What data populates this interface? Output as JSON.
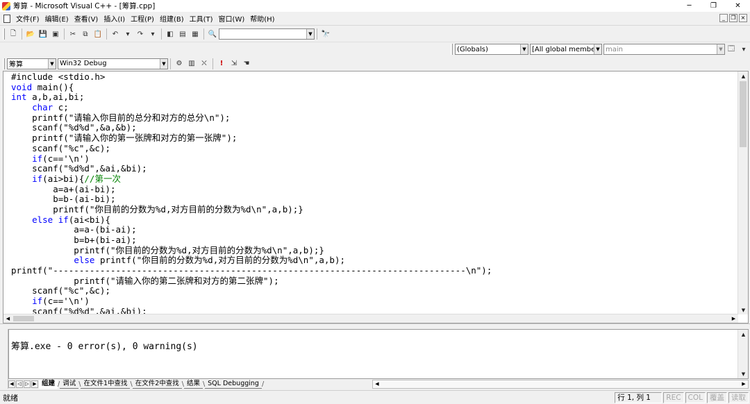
{
  "window": {
    "title": "筹算 - Microsoft Visual C++ - [筹算.cpp]",
    "minimize": "─",
    "maximize": "❐",
    "close": "✕"
  },
  "menu": {
    "items": [
      "文件(F)",
      "编辑(E)",
      "查看(V)",
      "插入(I)",
      "工程(P)",
      "组建(B)",
      "工具(T)",
      "窗口(W)",
      "帮助(H)"
    ],
    "mdi": [
      "_",
      "❐",
      "×"
    ]
  },
  "toolbar": {
    "find_combo_value": ""
  },
  "wizardbar": {
    "class_combo": "(Globals)",
    "filter_combo": "[All global members",
    "members_combo": "main"
  },
  "buildbar": {
    "project_combo": "筹算",
    "config_combo": "Win32 Debug"
  },
  "editor": {
    "lines": [
      [
        {
          "t": "#include <stdio.h>",
          "c": "pp"
        }
      ],
      [
        {
          "t": "void",
          "c": "kw"
        },
        {
          "t": " main(){"
        }
      ],
      [
        {
          "t": "int",
          "c": "kw"
        },
        {
          "t": " a,b,ai,bi;"
        }
      ],
      [
        {
          "t": "    "
        },
        {
          "t": "char",
          "c": "kw"
        },
        {
          "t": " c;"
        }
      ],
      [
        {
          "t": "    printf(\"请输入你目前的总分和对方的总分\\n\");"
        }
      ],
      [
        {
          "t": "    scanf(\"%d%d\",&a,&b);"
        }
      ],
      [
        {
          "t": "    printf(\"请输入你的第一张牌和对方的第一张牌\");"
        }
      ],
      [
        {
          "t": "    scanf(\"%c\",&c);"
        }
      ],
      [
        {
          "t": "    "
        },
        {
          "t": "if",
          "c": "kw"
        },
        {
          "t": "(c=='\\n')"
        }
      ],
      [
        {
          "t": "    scanf(\"%d%d\",&ai,&bi);"
        }
      ],
      [
        {
          "t": "    "
        },
        {
          "t": "if",
          "c": "kw"
        },
        {
          "t": "(ai>bi){"
        },
        {
          "t": "//第一次",
          "c": "cm"
        }
      ],
      [
        {
          "t": "        a=a+(ai-bi);"
        }
      ],
      [
        {
          "t": "        b=b-(ai-bi);"
        }
      ],
      [
        {
          "t": "        printf(\"你目前的分数为%d,对方目前的分数为%d\\n\",a,b);}"
        }
      ],
      [
        {
          "t": "    "
        },
        {
          "t": "else",
          "c": "kw"
        },
        {
          "t": " "
        },
        {
          "t": "if",
          "c": "kw"
        },
        {
          "t": "(ai<bi){"
        }
      ],
      [
        {
          "t": "            a=a-(bi-ai);"
        }
      ],
      [
        {
          "t": "            b=b+(bi-ai);"
        }
      ],
      [
        {
          "t": "            printf(\"你目前的分数为%d,对方目前的分数为%d\\n\",a,b);}"
        }
      ],
      [
        {
          "t": "            "
        },
        {
          "t": "else",
          "c": "kw"
        },
        {
          "t": " printf(\"你目前的分数为%d,对方目前的分数为%d\\n\",a,b);"
        }
      ],
      [
        {
          "t": "printf(\"-------------------------------------------------------------------------------\\n\");"
        }
      ],
      [
        {
          "t": "            printf(\"请输入你的第二张牌和对方的第二张牌\");"
        }
      ],
      [
        {
          "t": "    scanf(\"%c\",&c);"
        }
      ],
      [
        {
          "t": "    "
        },
        {
          "t": "if",
          "c": "kw"
        },
        {
          "t": "(c=='\\n')"
        }
      ],
      [
        {
          "t": "    scanf(\"%d%d\",&ai,&bi);"
        }
      ]
    ]
  },
  "output": {
    "text": "筹算.exe - 0 error(s), 0 warning(s)",
    "tabs": [
      "组建",
      "调试",
      "在文件1中查找",
      "在文件2中查找",
      "结果",
      "SQL Debugging"
    ],
    "active_tab": 0
  },
  "statusbar": {
    "message": "就绪",
    "position": "行 1, 列 1",
    "indicators": [
      "REC",
      "COL",
      "覆盖",
      "读取"
    ]
  },
  "colors": {
    "keyword": "#0000ff",
    "comment": "#008000",
    "text": "#000000"
  }
}
